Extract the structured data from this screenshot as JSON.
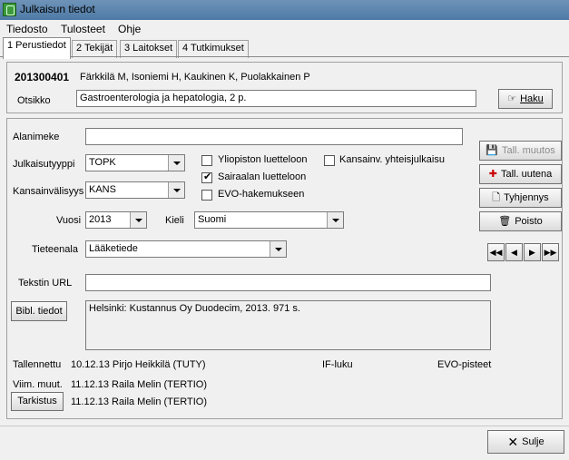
{
  "window": {
    "title": "Julkaisun tiedot"
  },
  "menu": [
    "Tiedosto",
    "Tulosteet",
    "Ohje"
  ],
  "tabs": [
    "1 Perustiedot",
    "2 Tekijät",
    "3 Laitokset",
    "4 Tutkimukset"
  ],
  "record": {
    "id": "201300401",
    "authors": "Färkkilä M, Isoniemi H, Kaukinen K, Puolakkainen P",
    "otsikko_label": "Otsikko",
    "otsikko_value": "Gastroenterologia ja hepatologia, 2 p.",
    "haku_label": "Haku"
  },
  "form": {
    "alanimeke_label": "Alanimeke",
    "alanimeke_value": "",
    "julkaisutyyppi_label": "Julkaisutyyppi",
    "julkaisutyyppi_value": "TOPK",
    "kansainvalisyys_label": "Kansainvälisyys",
    "kansainvalisyys_value": "KANS",
    "vuosi_label": "Vuosi",
    "vuosi_value": "2013",
    "kieli_label": "Kieli",
    "kieli_value": "Suomi",
    "tieteenala_label": "Tieteenala",
    "tieteenala_value": "Lääketiede",
    "url_label": "Tekstin URL",
    "url_value": "",
    "bibl_button": "Bibl. tiedot",
    "bibl_value": "Helsinki: Kustannus Oy Duodecim, 2013. 971 s."
  },
  "checkboxes": {
    "yliopisto": {
      "label": "Yliopiston luetteloon",
      "checked": false
    },
    "sairaala": {
      "label": "Sairaalan luetteloon",
      "checked": true
    },
    "evo": {
      "label": "EVO-hakemukseen",
      "checked": false
    },
    "kansainv": {
      "label": "Kansainv. yhteisjulkaisu",
      "checked": false
    }
  },
  "actions": {
    "tall_muutos": "Tall. muutos",
    "tall_uutena": "Tall. uutena",
    "tyhjennys": "Tyhjennys",
    "poisto": "Poisto"
  },
  "footer": {
    "tallennettu_label": "Tallennettu",
    "tallennettu_value": "10.12.13 Pirjo Heikkilä (TUTY)",
    "viim_label": "Viim. muut.",
    "viim_value": "11.12.13 Raila Melin (TERTIO)",
    "tarkistus_button": "Tarkistus",
    "tarkistus_value": "11.12.13 Raila Melin (TERTIO)",
    "if_label": "IF-luku",
    "evo_label": "EVO-pisteet"
  },
  "close_button": "Sulje"
}
